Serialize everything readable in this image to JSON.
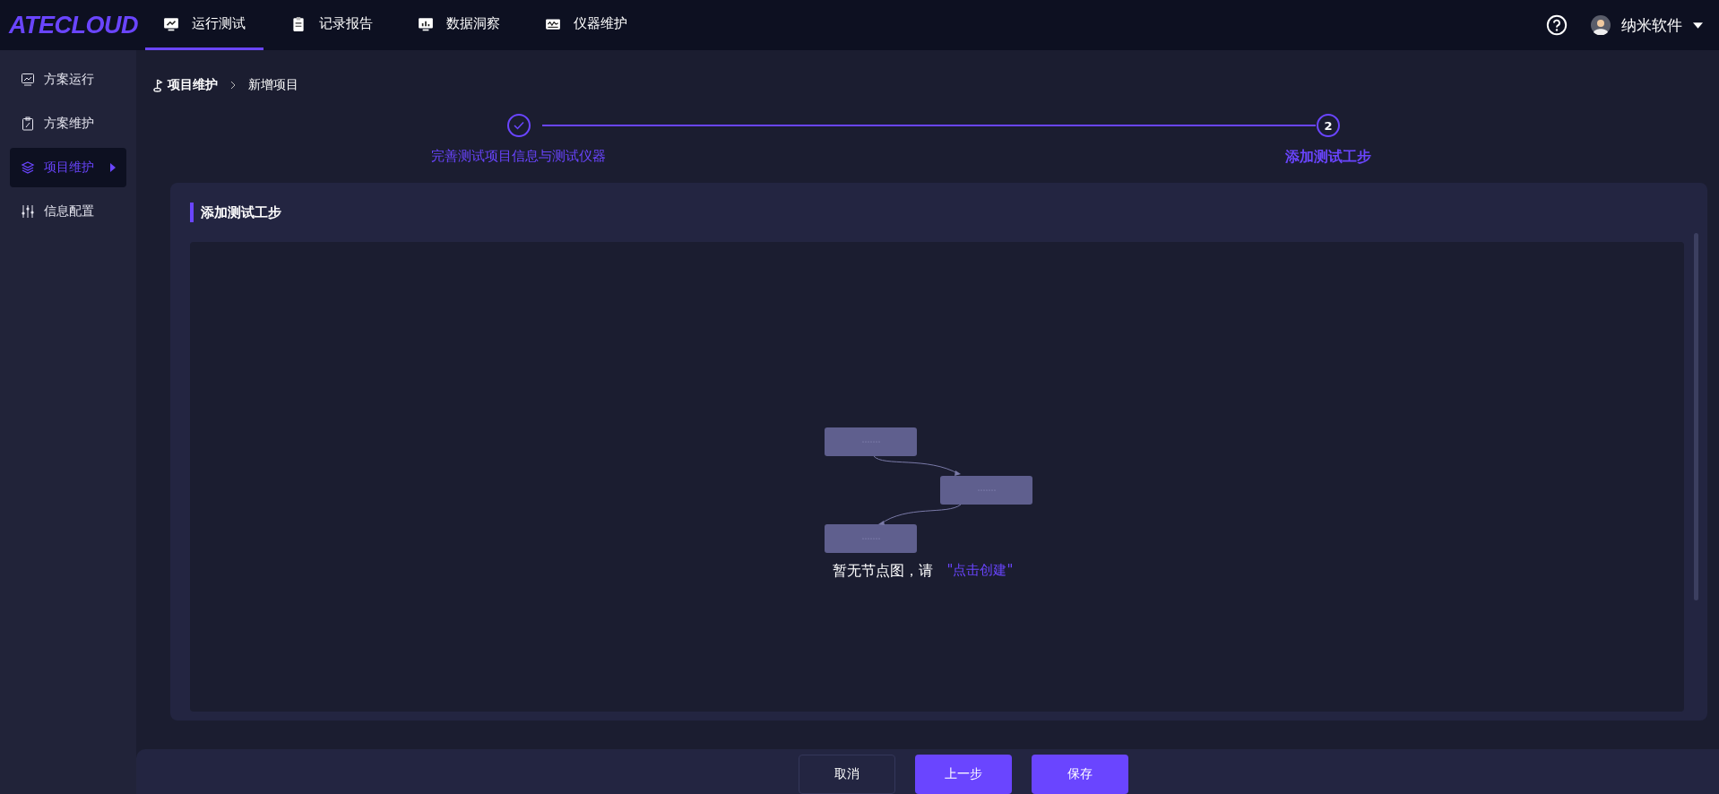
{
  "brand": "ATECLOUD",
  "nav": [
    {
      "label": "运行测试",
      "selected": true
    },
    {
      "label": "记录报告",
      "selected": false
    },
    {
      "label": "数据洞察",
      "selected": false
    },
    {
      "label": "仪器维护",
      "selected": false
    }
  ],
  "user": {
    "name": "纳米软件"
  },
  "sidebar": {
    "items": [
      {
        "label": "方案运行",
        "selected": false
      },
      {
        "label": "方案维护",
        "selected": false
      },
      {
        "label": "项目维护",
        "selected": true
      },
      {
        "label": "信息配置",
        "selected": false
      }
    ]
  },
  "breadcrumb": [
    "项目维护",
    "新增项目"
  ],
  "steps": [
    {
      "label": "完善测试项目信息与测试仪器",
      "completed": true
    },
    {
      "label": "添加测试工步",
      "completed": false,
      "number": "2"
    }
  ],
  "panel": {
    "title": "添加测试工步",
    "empty_text": "暂无节点图，请",
    "create_link": "\"点击创建\""
  },
  "buttons": [
    {
      "label": "取消",
      "kind": "secondary"
    },
    {
      "label": "上一步",
      "kind": "primary"
    },
    {
      "label": "保存",
      "kind": "primary"
    }
  ]
}
